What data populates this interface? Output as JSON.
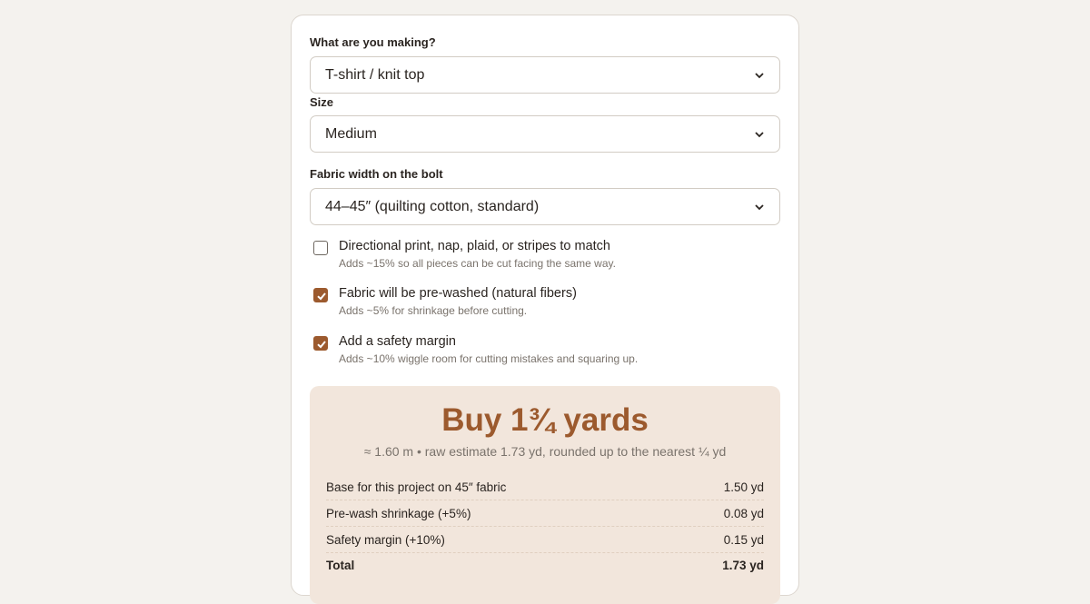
{
  "form": {
    "project_label": "What are you making?",
    "project_value": "T-shirt / knit top",
    "size_label": "Size",
    "size_value": "Medium",
    "width_label": "Fabric width on the bolt",
    "width_value": "44–45″ (quilting cotton, standard)"
  },
  "options": [
    {
      "title": "Directional print, nap, plaid, or stripes to match",
      "hint": "Adds ~15% so all pieces can be cut facing the same way.",
      "checked": false
    },
    {
      "title": "Fabric will be pre-washed (natural fibers)",
      "hint": "Adds ~5% for shrinkage before cutting.",
      "checked": true
    },
    {
      "title": "Add a safety margin",
      "hint": "Adds ~10% wiggle room for cutting mistakes and squaring up.",
      "checked": true
    }
  ],
  "result": {
    "headline": "Buy 1¾ yards",
    "subline": "≈ 1.60 m • raw estimate 1.73 yd, rounded up to the nearest ¼ yd",
    "rows": [
      {
        "label": "Base for this project on 45″ fabric",
        "value": "1.50 yd"
      },
      {
        "label": "Pre-wash shrinkage (+5%)",
        "value": "0.08 yd"
      },
      {
        "label": "Safety margin (+10%)",
        "value": "0.15 yd"
      },
      {
        "label": "Total",
        "value": "1.73 yd"
      }
    ]
  },
  "colors": {
    "accent": "#9c5a2e",
    "result_bg": "#f2e6dc",
    "page_bg": "#f4f2ee"
  }
}
